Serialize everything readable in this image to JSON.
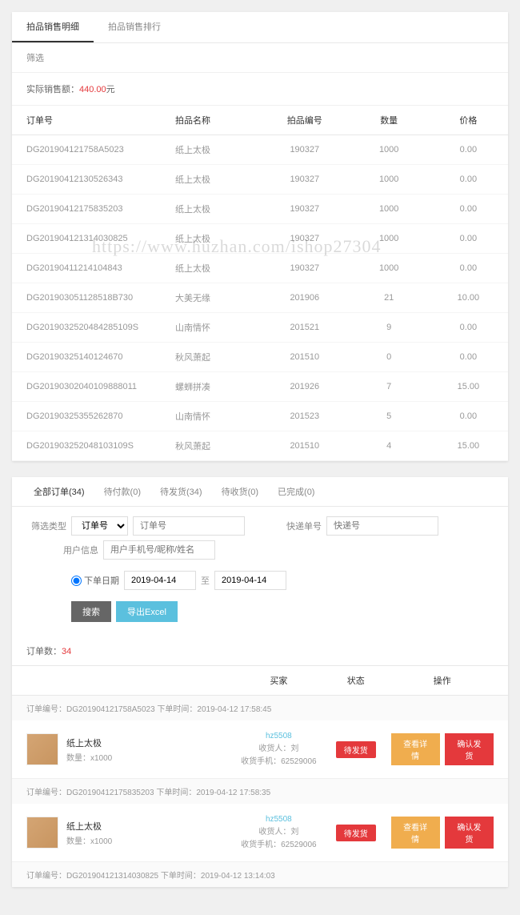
{
  "panel1": {
    "tabs": [
      "拍品销售明细",
      "拍品销售排行"
    ],
    "sub": "筛选",
    "total_label": "实际销售额：",
    "total_value": "440.00",
    "total_unit": "元",
    "columns": [
      "订单号",
      "拍品名称",
      "拍品编号",
      "数量",
      "价格"
    ],
    "rows": [
      [
        "DG201904121758A5023",
        "纸上太极",
        "190327",
        "1000",
        "0.00"
      ],
      [
        "DG20190412130526343",
        "纸上太极",
        "190327",
        "1000",
        "0.00"
      ],
      [
        "DG20190412175835203",
        "纸上太极",
        "190327",
        "1000",
        "0.00"
      ],
      [
        "DG201904121314030825",
        "纸上太极",
        "190327",
        "1000",
        "0.00"
      ],
      [
        "DG20190411214104843",
        "纸上太极",
        "190327",
        "1000",
        "0.00"
      ],
      [
        "DG201903051128518B730",
        "大美无缘",
        "201906",
        "21",
        "10.00"
      ],
      [
        "DG2019032520484285109S",
        "山南情怀",
        "201521",
        "9",
        "0.00"
      ],
      [
        "DG20190325140124670",
        "秋风萧起",
        "201510",
        "0",
        "0.00"
      ],
      [
        "DG20190302040109888011",
        "螺蛳拼凑",
        "201926",
        "7",
        "15.00"
      ],
      [
        "DG20190325355262870",
        "山南情怀",
        "201523",
        "5",
        "0.00"
      ],
      [
        "DG201903252048103109S",
        "秋风萧起",
        "201510",
        "4",
        "15.00"
      ]
    ]
  },
  "panel2": {
    "tabs": [
      "全部订单(34)",
      "待付款(0)",
      "待发货(34)",
      "待收货(0)",
      "已完成(0)"
    ],
    "filter": {
      "type_label": "筛选类型",
      "order_sel": "订单号",
      "order_ph": "订单号",
      "express_label": "快递单号",
      "express_ph": "快递号",
      "user_label": "用户信息",
      "user_ph": "用户手机号/昵称/姓名",
      "time_radio": "下单日期",
      "date_from": "2019-04-14",
      "date_to": "2019-04-14",
      "to": "至",
      "search_btn": "搜索",
      "export_btn": "导出Excel"
    },
    "count_label": "订单数：",
    "count": "34",
    "columns": [
      "",
      "买家",
      "状态",
      "操作"
    ],
    "orders": [
      {
        "meta": "订单编号：DG201904121758A5023  下单时间：2019-04-12 17:58:45",
        "name": "纸上太极",
        "num": "数量：x1000",
        "buyer_name": "hz5508",
        "buyer_p": "收货人：刘",
        "buyer_tel": "收货手机：62529006",
        "status": "待发货",
        "op1": "查看详情",
        "op2": "确认发货"
      },
      {
        "meta": "订单编号：DG20190412175835203  下单时间：2019-04-12 17:58:35",
        "name": "纸上太极",
        "num": "数量：x1000",
        "buyer_name": "hz5508",
        "buyer_p": "收货人：刘",
        "buyer_tel": "收货手机：62529006",
        "status": "待发货",
        "op1": "查看详情",
        "op2": "确认发货"
      }
    ],
    "last_meta": "订单编号：DG201904121314030825  下单时间：2019-04-12 13:14:03"
  },
  "watermark": "https://www.huzhan.com/ishop27304"
}
